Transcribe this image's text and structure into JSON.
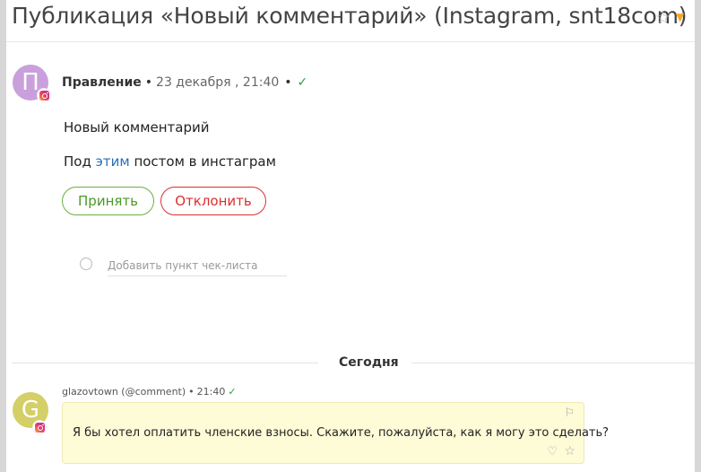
{
  "header": {
    "title": "Публикация «Новый комментарий» (Instagram, snt18com)"
  },
  "post": {
    "avatar_letter": "П",
    "author": "Правление",
    "date": "23 декабря , 21:40",
    "line1": "Новый комментарий",
    "line2_prefix": "Под",
    "line2_link": "этим",
    "line2_suffix": "постом в инстаграм",
    "accept_label": "Принять",
    "reject_label": "Отклонить",
    "checklist_placeholder": "Добавить пункт чек-листа"
  },
  "separator": {
    "label": "Сегодня"
  },
  "comment": {
    "avatar_letter": "G",
    "author": "glazovtown (@comment)",
    "time": "21:40",
    "text": "Я бы хотел оплатить членские взносы. Скажите, пожалуйста, как я могу это сделать?"
  },
  "colors": {
    "accept": "#4a9a26",
    "reject": "#d9302e",
    "link": "#2a6fb8",
    "avatar_post": "#c9a0dc",
    "avatar_comment": "#d4cf66",
    "bubble": "#fefbd7"
  },
  "icons": {
    "star": "star-outline-icon",
    "caret": "caret-down-icon",
    "read": "checkmark-icon",
    "flag": "flag-icon",
    "like": "heart-icon",
    "favorite": "star-icon",
    "source": "instagram-icon"
  }
}
